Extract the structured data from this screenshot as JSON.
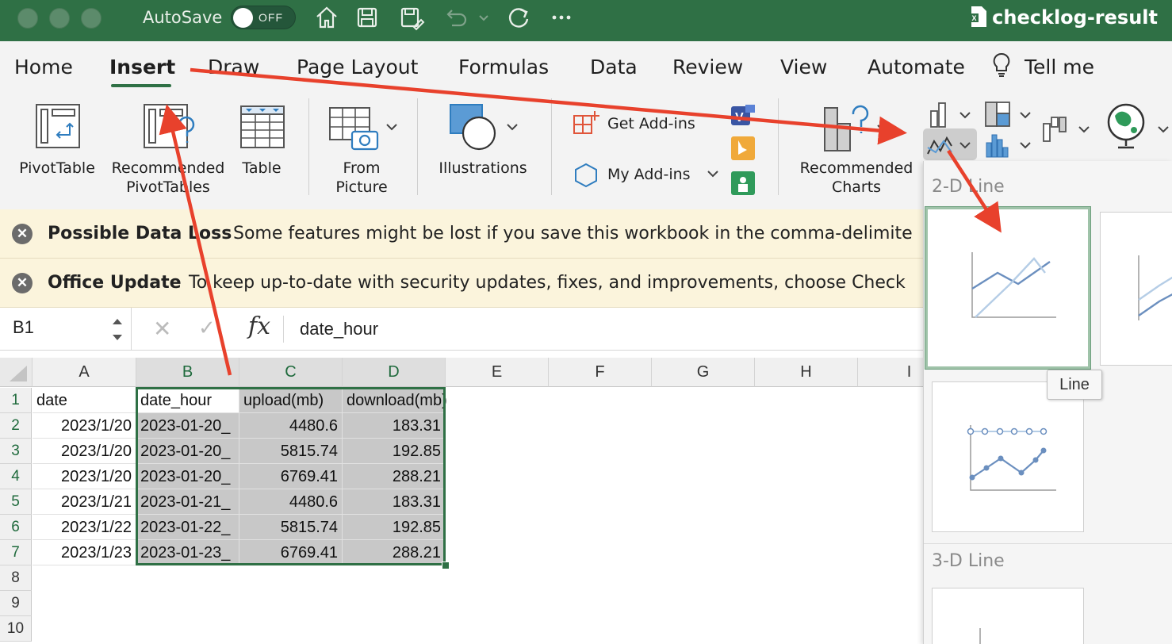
{
  "titlebar": {
    "autosave_label": "AutoSave",
    "autosave_state": "OFF",
    "doc_title": "checklog-result",
    "icons": [
      "home-icon",
      "save-icon",
      "save-as-icon",
      "undo-icon",
      "redo-icon",
      "more-icon"
    ]
  },
  "tabs": [
    "Home",
    "Insert",
    "Draw",
    "Page Layout",
    "Formulas",
    "Data",
    "Review",
    "View",
    "Automate",
    "Tell me"
  ],
  "ribbon": {
    "pivottable": "PivotTable",
    "recommended_pivot_1": "Recommended",
    "recommended_pivot_2": "PivotTables",
    "table": "Table",
    "from_picture_1": "From",
    "from_picture_2": "Picture",
    "illustrations": "Illustrations",
    "get_addins": "Get Add-ins",
    "my_addins": "My Add-ins",
    "recommended_charts_1": "Recommended",
    "recommended_charts_2": "Charts"
  },
  "messages": [
    {
      "title": "Possible Data Loss",
      "text": "Some features might be lost if you save this workbook in the comma-delimite"
    },
    {
      "title": "Office Update",
      "text": "To keep up-to-date with security updates, fixes, and improvements, choose Check"
    }
  ],
  "formula_bar": {
    "cell_ref": "B1",
    "cancel": "✕",
    "confirm": "✓",
    "fx": "fx",
    "value": "date_hour"
  },
  "sheet": {
    "columns": [
      "A",
      "B",
      "C",
      "D",
      "E",
      "F",
      "G",
      "H",
      "I"
    ],
    "rows": [
      "1",
      "2",
      "3",
      "4",
      "5",
      "6",
      "7",
      "8",
      "9",
      "10"
    ],
    "headers": [
      "date",
      "date_hour",
      "upload(mb)",
      "download(mb)"
    ],
    "data": [
      [
        "2023/1/20",
        "2023-01-20_",
        "4480.6",
        "183.31"
      ],
      [
        "2023/1/20",
        "2023-01-20_",
        "5815.74",
        "192.85"
      ],
      [
        "2023/1/20",
        "2023-01-20_",
        "6769.41",
        "288.21"
      ],
      [
        "2023/1/21",
        "2023-01-21_",
        "4480.6",
        "183.31"
      ],
      [
        "2023/1/22",
        "2023-01-22_",
        "5815.74",
        "192.85"
      ],
      [
        "2023/1/23",
        "2023-01-23_",
        "6769.41",
        "288.21"
      ]
    ]
  },
  "gallery": {
    "section_2d": "2-D Line",
    "section_3d": "3-D Line",
    "tooltip": "Line"
  },
  "colors": {
    "excel_green": "#2f7045",
    "annotation_red": "#e8412c",
    "selection_fill": "#c8c8c8"
  }
}
